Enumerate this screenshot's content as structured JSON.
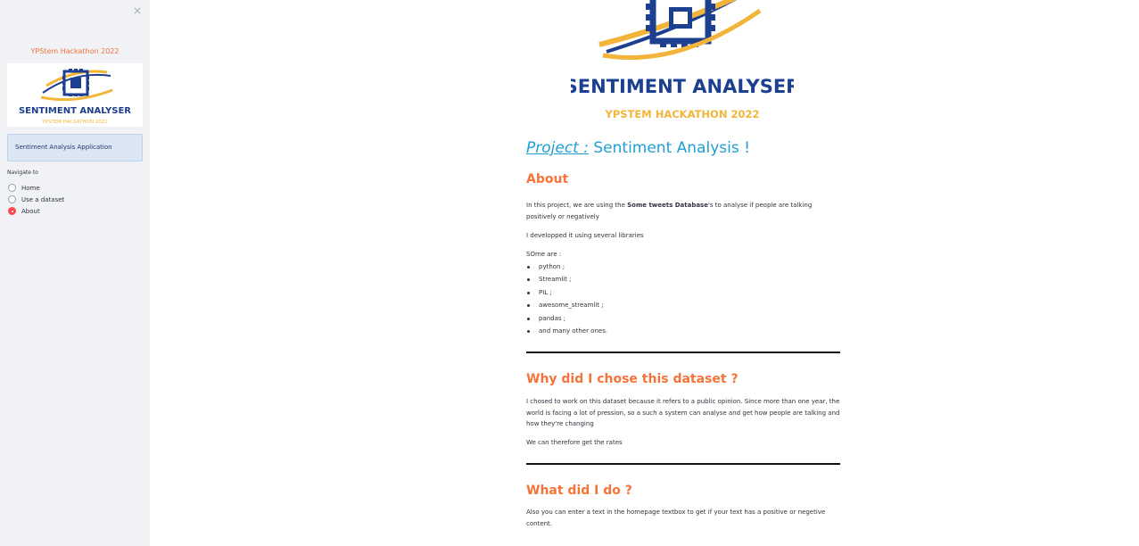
{
  "sidebar": {
    "close_icon": "×",
    "title": "YPStem Hackathon 2022",
    "logo": {
      "name": "SENTIMENT ANALYSER",
      "sub": "YPSTEM HACKATHON 2022"
    },
    "info": "Sentiment Analysis Application",
    "nav_label": "Navigate to",
    "nav_options": [
      {
        "label": "Home",
        "selected": false
      },
      {
        "label": "Use a dataset",
        "selected": false
      },
      {
        "label": "About",
        "selected": true
      }
    ]
  },
  "main": {
    "logo": {
      "name": "SENTIMENT ANALYSER",
      "sub": "YPSTEM HACKATHON 2022"
    },
    "project_label": "Project :",
    "project_title": " Sentiment Analysis !",
    "about": {
      "heading": "About",
      "p1_start": "In this project, we are using the ",
      "p1_bold": "Some tweets Database",
      "p1_end": "'s to analyse if people are talking positively or negatively",
      "p2": "I developped it using several libraries",
      "p3": "SOme are :",
      "libraries": [
        "python ;",
        "Streamlit ;",
        "PIL ;",
        "awesome_streamlit ;",
        "pandas ;",
        "and many other ones."
      ]
    },
    "why": {
      "heading": "Why did I chose this dataset ?",
      "p1": "I chosed to work on this dataset because it refers to a public opinion. Since more than one year, the world is facing a lot of pression, so a such a system can analyse and get how people are talking and how they're changing",
      "p2": "We can therefore get the rates"
    },
    "what": {
      "heading": "What did I do ?",
      "p1": "Also you can enter a text in the homepage textbox to get if your text has a positive or negetive content."
    }
  },
  "colors": {
    "accent": "#f6733a",
    "link": "#1f9ed6",
    "navy": "#1d3f8f",
    "gold": "#f2b53a",
    "radio": "#ff4b4b"
  }
}
